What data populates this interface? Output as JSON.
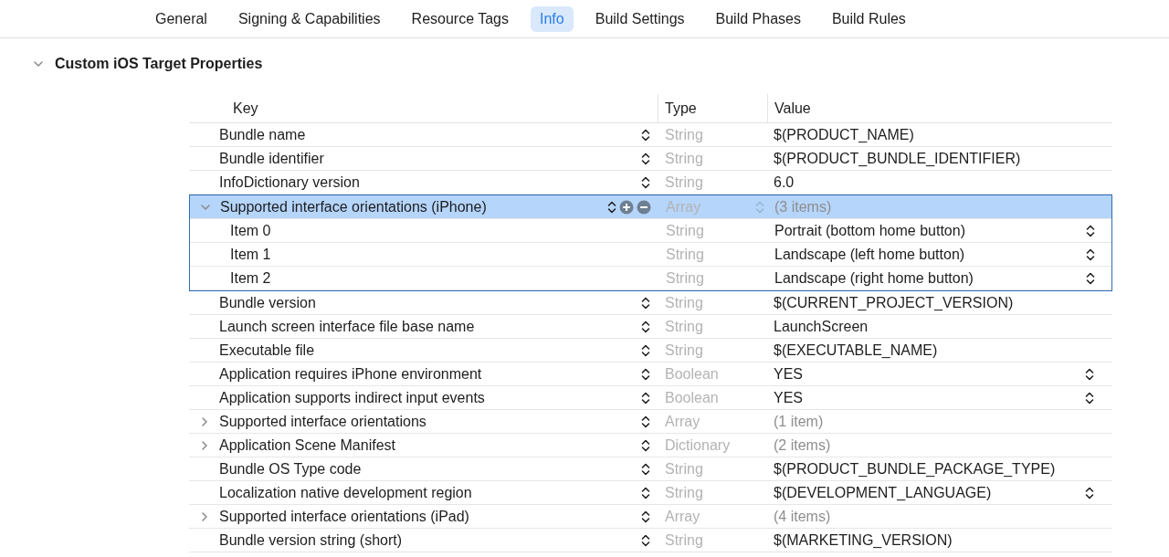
{
  "tabs": [
    {
      "label": "General",
      "selected": false
    },
    {
      "label": "Signing & Capabilities",
      "selected": false
    },
    {
      "label": "Resource Tags",
      "selected": false
    },
    {
      "label": "Info",
      "selected": true
    },
    {
      "label": "Build Settings",
      "selected": false
    },
    {
      "label": "Build Phases",
      "selected": false
    },
    {
      "label": "Build Rules",
      "selected": false
    }
  ],
  "section": {
    "title": "Custom iOS Target Properties",
    "expanded": true
  },
  "table": {
    "columns": [
      "Key",
      "Type",
      "Value"
    ],
    "rows": [
      {
        "key": "Bundle name",
        "type": "String",
        "value": "$(PRODUCT_NAME)",
        "expandable": false,
        "key_stepper": true,
        "value_stepper": false,
        "selected": false
      },
      {
        "key": "Bundle identifier",
        "type": "String",
        "value": "$(PRODUCT_BUNDLE_IDENTIFIER)",
        "expandable": false,
        "key_stepper": true,
        "value_stepper": false,
        "selected": false
      },
      {
        "key": "InfoDictionary version",
        "type": "String",
        "value": "6.0",
        "expandable": false,
        "key_stepper": true,
        "value_stepper": false,
        "selected": false
      },
      {
        "key": "Supported interface orientations (iPhone)",
        "type": "Array",
        "value": "(3 items)",
        "expandable": true,
        "expanded": true,
        "key_stepper": true,
        "value_stepper": false,
        "selected": true,
        "children": [
          {
            "key": "Item 0",
            "type": "String",
            "value": "Portrait (bottom home button)",
            "expandable": false,
            "key_stepper": false,
            "value_stepper": true,
            "selected": false
          },
          {
            "key": "Item 1",
            "type": "String",
            "value": "Landscape (left home button)",
            "expandable": false,
            "key_stepper": false,
            "value_stepper": true,
            "selected": false
          },
          {
            "key": "Item 2",
            "type": "String",
            "value": "Landscape (right home button)",
            "expandable": false,
            "key_stepper": false,
            "value_stepper": true,
            "selected": false
          }
        ]
      },
      {
        "key": "Bundle version",
        "type": "String",
        "value": "$(CURRENT_PROJECT_VERSION)",
        "expandable": false,
        "key_stepper": true,
        "value_stepper": false,
        "selected": false
      },
      {
        "key": "Launch screen interface file base name",
        "type": "String",
        "value": "LaunchScreen",
        "expandable": false,
        "key_stepper": true,
        "value_stepper": false,
        "selected": false
      },
      {
        "key": "Executable file",
        "type": "String",
        "value": "$(EXECUTABLE_NAME)",
        "expandable": false,
        "key_stepper": true,
        "value_stepper": false,
        "selected": false
      },
      {
        "key": "Application requires iPhone environment",
        "type": "Boolean",
        "value": "YES",
        "expandable": false,
        "key_stepper": true,
        "value_stepper": true,
        "selected": false
      },
      {
        "key": "Application supports indirect input events",
        "type": "Boolean",
        "value": "YES",
        "expandable": false,
        "key_stepper": true,
        "value_stepper": true,
        "selected": false
      },
      {
        "key": "Supported interface orientations",
        "type": "Array",
        "value": "(1 item)",
        "expandable": true,
        "expanded": false,
        "key_stepper": true,
        "value_stepper": false,
        "selected": false
      },
      {
        "key": "Application Scene Manifest",
        "type": "Dictionary",
        "value": "(2 items)",
        "expandable": true,
        "expanded": false,
        "key_stepper": true,
        "value_stepper": false,
        "selected": false
      },
      {
        "key": "Bundle OS Type code",
        "type": "String",
        "value": "$(PRODUCT_BUNDLE_PACKAGE_TYPE)",
        "expandable": false,
        "key_stepper": true,
        "value_stepper": false,
        "selected": false
      },
      {
        "key": "Localization native development region",
        "type": "String",
        "value": "$(DEVELOPMENT_LANGUAGE)",
        "expandable": false,
        "key_stepper": true,
        "value_stepper": true,
        "selected": false
      },
      {
        "key": "Supported interface orientations (iPad)",
        "type": "Array",
        "value": "(4 items)",
        "expandable": true,
        "expanded": false,
        "key_stepper": true,
        "value_stepper": false,
        "selected": false
      },
      {
        "key": "Bundle version string (short)",
        "type": "String",
        "value": "$(MARKETING_VERSION)",
        "expandable": false,
        "key_stepper": true,
        "value_stepper": false,
        "selected": false
      }
    ]
  }
}
